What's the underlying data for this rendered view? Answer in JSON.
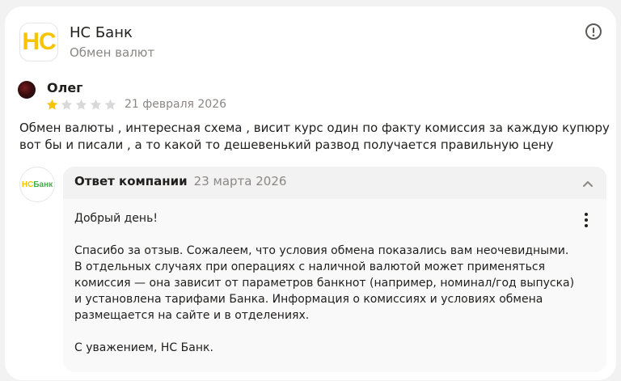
{
  "org": {
    "logo_text": "HC",
    "name": "НС Банк",
    "subtitle": "Обмен валют"
  },
  "review": {
    "author": "Олег",
    "rating": 1,
    "rating_max": 5,
    "date": "21 февраля 2026",
    "text": "Обмен валюты , интересная схема , висит курс один по факту комиссия за каждую купюру вот бы и писали , а то какой то дешевенький развод получается правильную цену"
  },
  "reply": {
    "logo_text_hc": "НС",
    "logo_text_bank": "Банк",
    "title": "Ответ компании",
    "date": "23 марта 2026",
    "greeting": "Добрый день!",
    "body": "Спасибо за отзыв. Сожалеем, что условия обмена показались вам неочевидными. В отдельных случаях при операциях с наличной валютой может применяться комиссия — она зависит от параметров банкнот (например, номинал/год выпуска) и установлена тарифами Банка. Информация о комиссиях и условиях обмена размещается на сайте и в отделениях.",
    "signature": "С уважением, НС Банк."
  },
  "colors": {
    "star_filled": "#f6c500",
    "star_empty": "#d9d9d9",
    "brand_yellow": "#f6c500",
    "brand_green": "#3fae49",
    "muted_text": "#8a8784"
  },
  "icons": {
    "info": "info-circle-icon",
    "chevron": "chevron-up-icon",
    "more": "more-vertical-icon"
  }
}
